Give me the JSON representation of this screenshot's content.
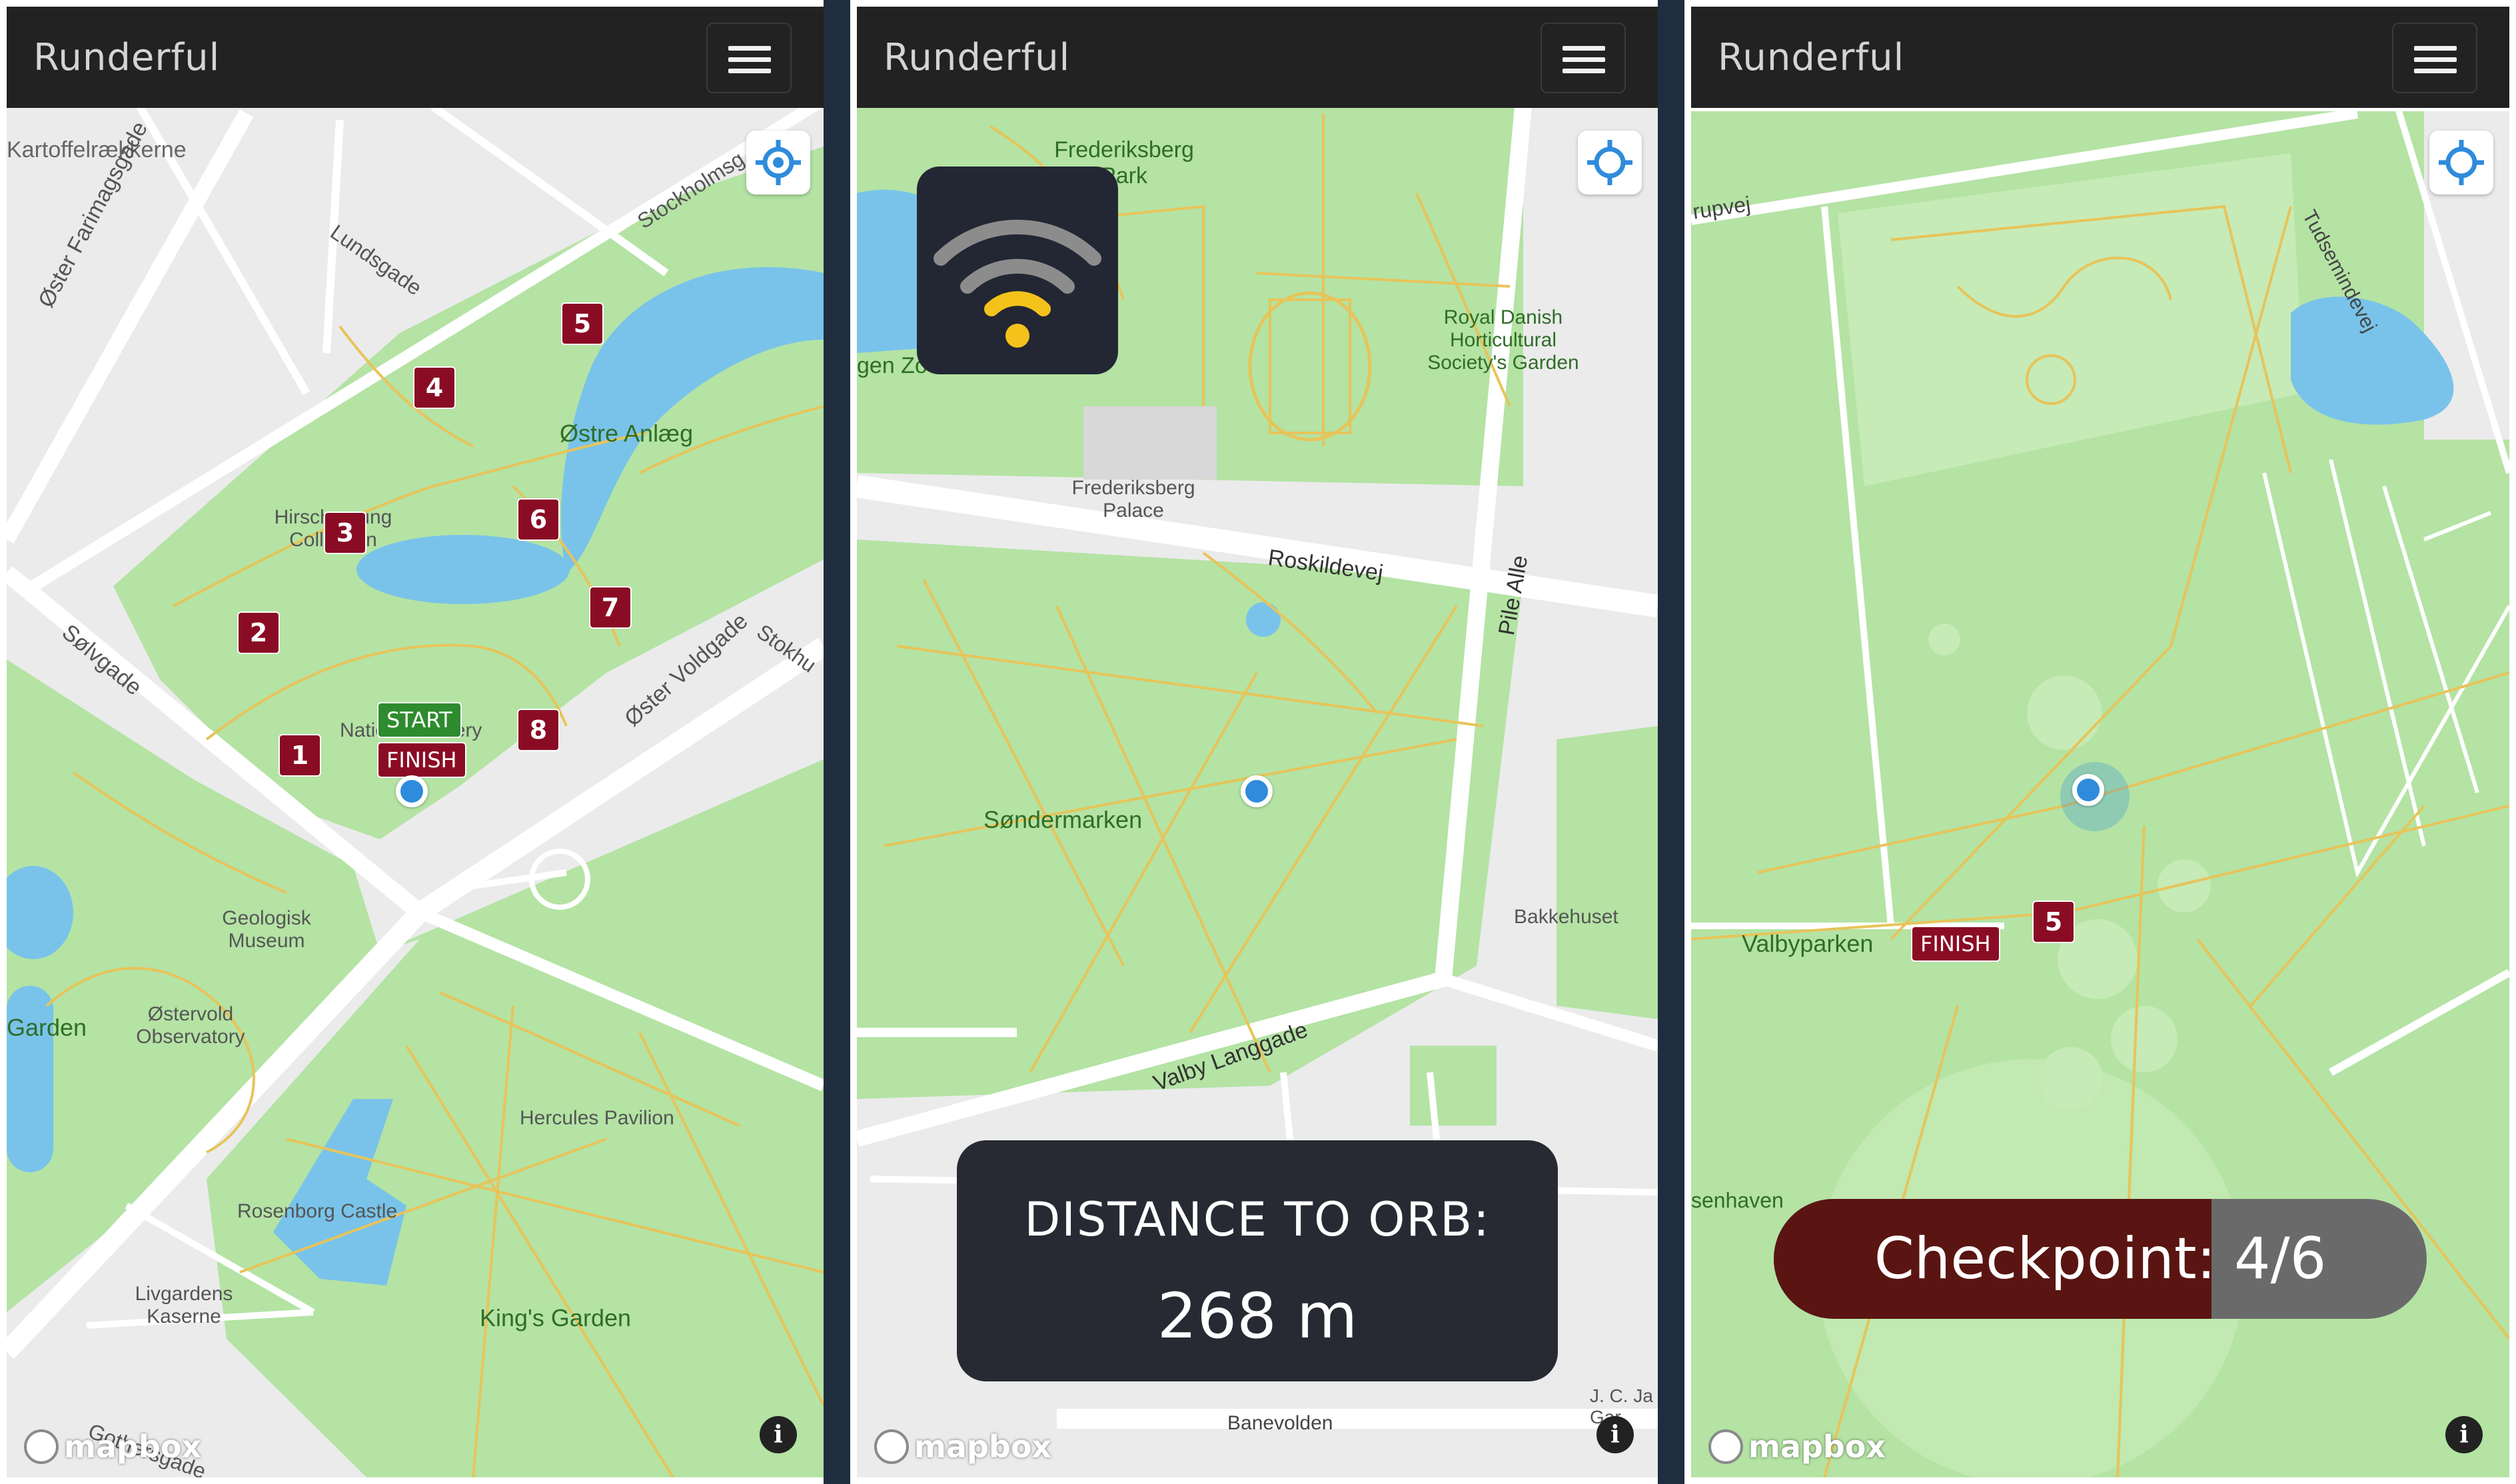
{
  "app": {
    "title": "Runderful"
  },
  "icons": {
    "menu": "hamburger-icon",
    "locate": "crosshair-icon",
    "info": "info-icon",
    "signal": "wifi-icon",
    "logo": "mapbox-logo"
  },
  "colors": {
    "topbar": "#222222",
    "park": "#b4e3a4",
    "water": "#79c3ea",
    "land": "#ebebeb",
    "checkpoint": "#8a0c24",
    "start": "#2e8b2e",
    "user": "#2f8bdb"
  },
  "panels": [
    {
      "map_labels": [
        "Kartoffelrækkerne",
        "Øster Farimagsgade",
        "Lundsgade",
        "Stockholmsg",
        "Østre Anlæg",
        "Hirschsprung Collection",
        "Sølvgade",
        "Øster Voldgade",
        "Stokhu",
        "National Gallery",
        "Geologisk Museum",
        "Østervold Observatory",
        "Garden",
        "Hercules Pavilion",
        "Rosenborg Castle",
        "Livgardens Kaserne",
        "King's Garden",
        "Gothersgade"
      ],
      "markers": [
        "1",
        "2",
        "3",
        "4",
        "5",
        "6",
        "7",
        "8"
      ],
      "start_label": "START",
      "finish_label": "FINISH",
      "logo_text": "mapbox",
      "info_text": "i"
    },
    {
      "map_labels": [
        "Frederiksberg Park",
        "gen Zo",
        "Royal Danish Horticultural Society's Garden",
        "Frederiksberg Palace",
        "Roskildevej",
        "Pile Alle",
        "Søndermarken",
        "Bakkehuset",
        "Valby Langgade",
        "Banevolden",
        "J. C. Ja Gar"
      ],
      "distance_label": "DISTANCE TO ORB:",
      "distance_value": "268 m",
      "logo_text": "mapbox",
      "info_text": "i"
    },
    {
      "map_labels": [
        "rupvej",
        "Tudsemindevej",
        "Valbyparken",
        "senhaven"
      ],
      "markers": [
        "5"
      ],
      "finish_label": "FINISH",
      "checkpoint_label": "Checkpoint:",
      "checkpoint_value": "4/6",
      "checkpoint_progress": 0.67,
      "logo_text": "mapbox",
      "info_text": "i"
    }
  ]
}
